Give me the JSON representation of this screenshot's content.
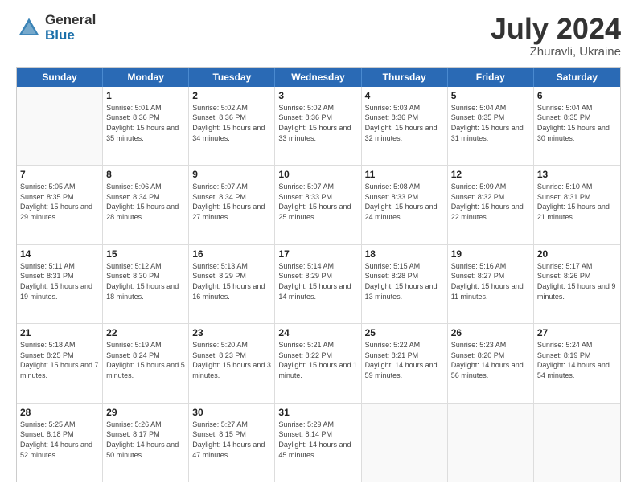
{
  "header": {
    "logo_general": "General",
    "logo_blue": "Blue",
    "title": "July 2024",
    "location": "Zhuravli, Ukraine"
  },
  "weekdays": [
    "Sunday",
    "Monday",
    "Tuesday",
    "Wednesday",
    "Thursday",
    "Friday",
    "Saturday"
  ],
  "weeks": [
    [
      {
        "day": "",
        "sunrise": "",
        "sunset": "",
        "daylight": ""
      },
      {
        "day": "1",
        "sunrise": "Sunrise: 5:01 AM",
        "sunset": "Sunset: 8:36 PM",
        "daylight": "Daylight: 15 hours and 35 minutes."
      },
      {
        "day": "2",
        "sunrise": "Sunrise: 5:02 AM",
        "sunset": "Sunset: 8:36 PM",
        "daylight": "Daylight: 15 hours and 34 minutes."
      },
      {
        "day": "3",
        "sunrise": "Sunrise: 5:02 AM",
        "sunset": "Sunset: 8:36 PM",
        "daylight": "Daylight: 15 hours and 33 minutes."
      },
      {
        "day": "4",
        "sunrise": "Sunrise: 5:03 AM",
        "sunset": "Sunset: 8:36 PM",
        "daylight": "Daylight: 15 hours and 32 minutes."
      },
      {
        "day": "5",
        "sunrise": "Sunrise: 5:04 AM",
        "sunset": "Sunset: 8:35 PM",
        "daylight": "Daylight: 15 hours and 31 minutes."
      },
      {
        "day": "6",
        "sunrise": "Sunrise: 5:04 AM",
        "sunset": "Sunset: 8:35 PM",
        "daylight": "Daylight: 15 hours and 30 minutes."
      }
    ],
    [
      {
        "day": "7",
        "sunrise": "Sunrise: 5:05 AM",
        "sunset": "Sunset: 8:35 PM",
        "daylight": "Daylight: 15 hours and 29 minutes."
      },
      {
        "day": "8",
        "sunrise": "Sunrise: 5:06 AM",
        "sunset": "Sunset: 8:34 PM",
        "daylight": "Daylight: 15 hours and 28 minutes."
      },
      {
        "day": "9",
        "sunrise": "Sunrise: 5:07 AM",
        "sunset": "Sunset: 8:34 PM",
        "daylight": "Daylight: 15 hours and 27 minutes."
      },
      {
        "day": "10",
        "sunrise": "Sunrise: 5:07 AM",
        "sunset": "Sunset: 8:33 PM",
        "daylight": "Daylight: 15 hours and 25 minutes."
      },
      {
        "day": "11",
        "sunrise": "Sunrise: 5:08 AM",
        "sunset": "Sunset: 8:33 PM",
        "daylight": "Daylight: 15 hours and 24 minutes."
      },
      {
        "day": "12",
        "sunrise": "Sunrise: 5:09 AM",
        "sunset": "Sunset: 8:32 PM",
        "daylight": "Daylight: 15 hours and 22 minutes."
      },
      {
        "day": "13",
        "sunrise": "Sunrise: 5:10 AM",
        "sunset": "Sunset: 8:31 PM",
        "daylight": "Daylight: 15 hours and 21 minutes."
      }
    ],
    [
      {
        "day": "14",
        "sunrise": "Sunrise: 5:11 AM",
        "sunset": "Sunset: 8:31 PM",
        "daylight": "Daylight: 15 hours and 19 minutes."
      },
      {
        "day": "15",
        "sunrise": "Sunrise: 5:12 AM",
        "sunset": "Sunset: 8:30 PM",
        "daylight": "Daylight: 15 hours and 18 minutes."
      },
      {
        "day": "16",
        "sunrise": "Sunrise: 5:13 AM",
        "sunset": "Sunset: 8:29 PM",
        "daylight": "Daylight: 15 hours and 16 minutes."
      },
      {
        "day": "17",
        "sunrise": "Sunrise: 5:14 AM",
        "sunset": "Sunset: 8:29 PM",
        "daylight": "Daylight: 15 hours and 14 minutes."
      },
      {
        "day": "18",
        "sunrise": "Sunrise: 5:15 AM",
        "sunset": "Sunset: 8:28 PM",
        "daylight": "Daylight: 15 hours and 13 minutes."
      },
      {
        "day": "19",
        "sunrise": "Sunrise: 5:16 AM",
        "sunset": "Sunset: 8:27 PM",
        "daylight": "Daylight: 15 hours and 11 minutes."
      },
      {
        "day": "20",
        "sunrise": "Sunrise: 5:17 AM",
        "sunset": "Sunset: 8:26 PM",
        "daylight": "Daylight: 15 hours and 9 minutes."
      }
    ],
    [
      {
        "day": "21",
        "sunrise": "Sunrise: 5:18 AM",
        "sunset": "Sunset: 8:25 PM",
        "daylight": "Daylight: 15 hours and 7 minutes."
      },
      {
        "day": "22",
        "sunrise": "Sunrise: 5:19 AM",
        "sunset": "Sunset: 8:24 PM",
        "daylight": "Daylight: 15 hours and 5 minutes."
      },
      {
        "day": "23",
        "sunrise": "Sunrise: 5:20 AM",
        "sunset": "Sunset: 8:23 PM",
        "daylight": "Daylight: 15 hours and 3 minutes."
      },
      {
        "day": "24",
        "sunrise": "Sunrise: 5:21 AM",
        "sunset": "Sunset: 8:22 PM",
        "daylight": "Daylight: 15 hours and 1 minute."
      },
      {
        "day": "25",
        "sunrise": "Sunrise: 5:22 AM",
        "sunset": "Sunset: 8:21 PM",
        "daylight": "Daylight: 14 hours and 59 minutes."
      },
      {
        "day": "26",
        "sunrise": "Sunrise: 5:23 AM",
        "sunset": "Sunset: 8:20 PM",
        "daylight": "Daylight: 14 hours and 56 minutes."
      },
      {
        "day": "27",
        "sunrise": "Sunrise: 5:24 AM",
        "sunset": "Sunset: 8:19 PM",
        "daylight": "Daylight: 14 hours and 54 minutes."
      }
    ],
    [
      {
        "day": "28",
        "sunrise": "Sunrise: 5:25 AM",
        "sunset": "Sunset: 8:18 PM",
        "daylight": "Daylight: 14 hours and 52 minutes."
      },
      {
        "day": "29",
        "sunrise": "Sunrise: 5:26 AM",
        "sunset": "Sunset: 8:17 PM",
        "daylight": "Daylight: 14 hours and 50 minutes."
      },
      {
        "day": "30",
        "sunrise": "Sunrise: 5:27 AM",
        "sunset": "Sunset: 8:15 PM",
        "daylight": "Daylight: 14 hours and 47 minutes."
      },
      {
        "day": "31",
        "sunrise": "Sunrise: 5:29 AM",
        "sunset": "Sunset: 8:14 PM",
        "daylight": "Daylight: 14 hours and 45 minutes."
      },
      {
        "day": "",
        "sunrise": "",
        "sunset": "",
        "daylight": ""
      },
      {
        "day": "",
        "sunrise": "",
        "sunset": "",
        "daylight": ""
      },
      {
        "day": "",
        "sunrise": "",
        "sunset": "",
        "daylight": ""
      }
    ]
  ]
}
